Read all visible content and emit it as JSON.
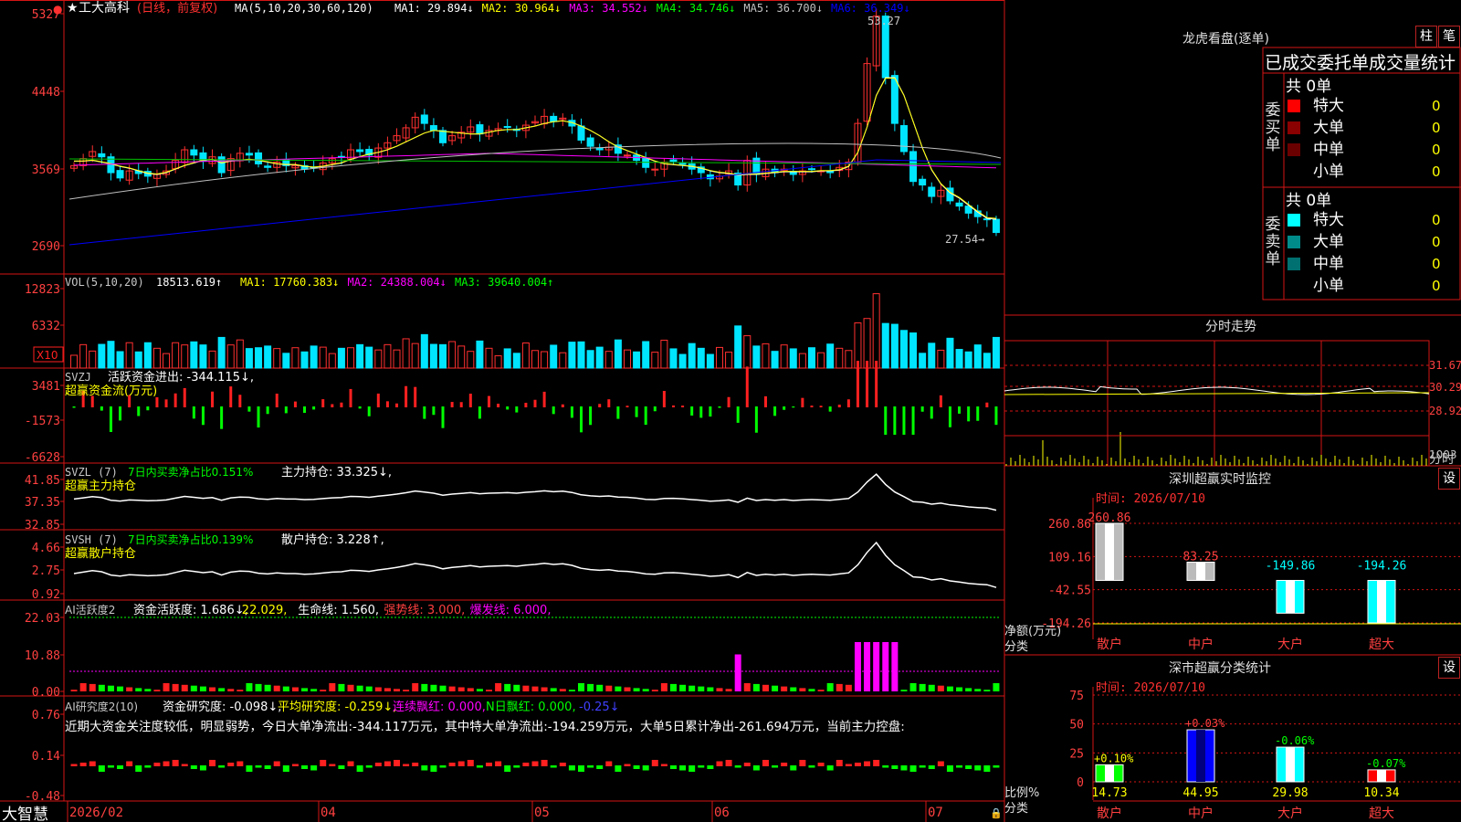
{
  "app": {
    "name": "大智慧"
  },
  "main": {
    "title": "工大高科",
    "mode": "(日线，前复权)",
    "ma_label": "MA(5,10,20,30,60,120)",
    "ma_values": [
      {
        "name": "MA1",
        "value": "29.894↓",
        "color": "#ffffff"
      },
      {
        "name": "MA2",
        "value": "30.964↓",
        "color": "#ffff00"
      },
      {
        "name": "MA3",
        "value": "34.552↓",
        "color": "#ff00ff"
      },
      {
        "name": "MA4",
        "value": "34.746↓",
        "color": "#00ff00"
      },
      {
        "name": "MA5",
        "value": "36.700↓",
        "color": "#c0c0c0"
      },
      {
        "name": "MA6",
        "value": "36.349↓",
        "color": "#0000ff"
      }
    ],
    "y_ticks": [
      "5327",
      "4448",
      "3569",
      "2690"
    ],
    "high_label": "53.27",
    "low_label": "27.54→"
  },
  "volume": {
    "label": "VOL(5,10,20)",
    "value": "18513.619↑",
    "ma": [
      {
        "name": "MA1",
        "value": "17760.383↓",
        "color": "#ffff00"
      },
      {
        "name": "MA2",
        "value": "24388.004↓",
        "color": "#ff00ff"
      },
      {
        "name": "MA3",
        "value": "39640.004↑",
        "color": "#00ff00"
      }
    ],
    "y_ticks": [
      "12823",
      "6332"
    ],
    "unit": "X10"
  },
  "svzj": {
    "label": "SVZJ",
    "text": "活跃资金进出: -344.115↓,",
    "sub": "超赢资金流(万元)",
    "y_ticks": [
      "3481",
      "-1573",
      "-6628"
    ]
  },
  "svzl": {
    "label": "SVZL (7)",
    "green_text": "7日内买卖净占比0.151%",
    "text": "主力持仓: 33.325↓,",
    "sub": "超赢主力持仓",
    "y_ticks": [
      "41.85",
      "37.35",
      "32.85"
    ]
  },
  "svsh": {
    "label": "SVSH (7)",
    "green_text": "7日内买卖净占比0.139%",
    "text": "散户持仓: 3.228↑,",
    "sub": "超赢散户持仓",
    "y_ticks": [
      "4.66",
      "2.75",
      "0.92"
    ]
  },
  "ai_active": {
    "label": "AI活跃度2",
    "parts": [
      {
        "text": "资金活跃度: 1.686↓,",
        "color": "#ffffff"
      },
      {
        "text": "22.029,",
        "color": "#ffff00"
      },
      {
        "text": "生命线: 1.560,",
        "color": "#ffffff"
      },
      {
        "text": "强势线: 3.000,",
        "color": "#ff4040"
      },
      {
        "text": "爆发线: 6.000,",
        "color": "#ff00ff"
      }
    ],
    "y_ticks": [
      "22.03",
      "10.88",
      "0.00"
    ]
  },
  "ai_research": {
    "label": "AI研究度2(10)",
    "parts": [
      {
        "text": "资金研究度: -0.098↓,",
        "color": "#ffffff"
      },
      {
        "text": "平均研究度: -0.259↓,",
        "color": "#ffff00"
      },
      {
        "text": "连续飘红: 0.000,",
        "color": "#ff00ff"
      },
      {
        "text": "N日飘红: 0.000,",
        "color": "#00ff00"
      },
      {
        "text": "-0.25↓",
        "color": "#4040ff"
      }
    ],
    "comment": "近期大资金关注度较低，明显弱势，今日大单净流出:-344.117万元，其中特大单净流出:-194.259万元，大单5日累计净出-261.694万元，当前主力控盘:",
    "y_ticks": [
      "0.76",
      "0.14",
      "-0.48"
    ]
  },
  "x_axis": {
    "labels": [
      "2026/02",
      "04",
      "05",
      "06",
      "07"
    ]
  },
  "dragon": {
    "title": "龙虎看盘(逐单)",
    "btn1": "柱",
    "btn2": "笔",
    "header": "已成交委托单成交量统计",
    "buy": {
      "side": "委买单",
      "total": "共 0单",
      "rows": [
        {
          "name": "特大",
          "val": "0",
          "pct": "0%",
          "color": "#ff0000"
        },
        {
          "name": "大单",
          "val": "0",
          "pct": "0%",
          "color": "#8b0000"
        },
        {
          "name": "中单",
          "val": "0",
          "pct": "0%",
          "color": "#6b0000"
        },
        {
          "name": "小单",
          "val": "0",
          "pct": "0%",
          "color": "#000000"
        }
      ]
    },
    "sell": {
      "side": "委卖单",
      "total": "共 0单",
      "rows": [
        {
          "name": "特大",
          "val": "0",
          "pct": "0%",
          "color": "#00ffff"
        },
        {
          "name": "大单",
          "val": "0",
          "pct": "0%",
          "color": "#008b8b"
        },
        {
          "name": "中单",
          "val": "0",
          "pct": "0%",
          "color": "#007070"
        },
        {
          "name": "小单",
          "val": "0",
          "pct": "0%",
          "color": "#000000"
        }
      ]
    }
  },
  "intraday": {
    "title": "分时走势",
    "y_ticks": [
      "31.67",
      "30.29",
      "28.92"
    ],
    "vol_tick": "1003",
    "vol_unit": "分时"
  },
  "sz_monitor": {
    "title": "深圳超赢实时监控",
    "btn": "设",
    "time": "时间: 2026/07/10",
    "y_ticks": [
      "260.86",
      "109.16",
      "-42.55",
      "-194.26"
    ],
    "ylabel": "净额(万元)",
    "xlabel": "分类"
  },
  "sz_class": {
    "title": "深市超赢分类统计",
    "btn": "设",
    "time": "时间: 2026/07/10",
    "y_ticks": [
      "75",
      "50",
      "25",
      "0"
    ],
    "ylabel": "比例%",
    "xlabel": "分类"
  },
  "chart_data": [
    {
      "type": "bar",
      "title": "深圳超赢实时监控",
      "ylabel": "净额(万元)",
      "xlabel": "分类",
      "categories": [
        "散户",
        "中户",
        "大户",
        "超大"
      ],
      "values": [
        260.86,
        83.25,
        -149.86,
        -194.26
      ],
      "labels": [
        "260.86",
        "83.25",
        "-149.86",
        "-194.26"
      ],
      "ylim": [
        -194.26,
        260.86
      ]
    },
    {
      "type": "bar",
      "title": "深市超赢分类统计",
      "ylabel": "比例%",
      "xlabel": "分类",
      "categories": [
        "散户",
        "中户",
        "大户",
        "超大"
      ],
      "values": [
        14.73,
        44.95,
        29.98,
        10.34
      ],
      "labels": [
        "14.73",
        "44.95",
        "29.98",
        "10.34"
      ],
      "changes": [
        "+0.10%",
        "+0.03%",
        "-0.06%",
        "-0.07%"
      ],
      "colors": [
        "#00ff00",
        "#0000ff",
        "#00ffff",
        "#ff0000"
      ],
      "ylim": [
        0,
        75
      ]
    },
    {
      "type": "line",
      "title": "工大高科",
      "series": [
        {
          "name": "close",
          "values": [
            36.0,
            36.8,
            37.6,
            37.0,
            35.2,
            34.6,
            35.4,
            35.1,
            34.8,
            35.0,
            35.4,
            36.6,
            37.8,
            37.2,
            36.5,
            37.0,
            35.2,
            36.8,
            37.4,
            37.2,
            36.2,
            35.8,
            36.4,
            36.0,
            36.0,
            35.6,
            35.8,
            36.3,
            36.8,
            37.0,
            37.8,
            37.6,
            37.2,
            38.0,
            38.6,
            39.4,
            40.3,
            41.5,
            40.8,
            40.0,
            38.6,
            39.4,
            39.8,
            40.4,
            39.6,
            40.0,
            40.2,
            40.4,
            40.0,
            40.6,
            41.0,
            41.6,
            41.0,
            41.4,
            40.5,
            38.9,
            38.2,
            37.8,
            38.1,
            37.4,
            37.2,
            36.6,
            35.8,
            35.6,
            36.4,
            36.5,
            36.2,
            35.6,
            35.2,
            34.5,
            34.8,
            35.4,
            33.8,
            36.6,
            35.0,
            35.6,
            35.2,
            35.6,
            35.0,
            35.4,
            35.6,
            35.4,
            35.2,
            35.8,
            36.4,
            40.8,
            47.6,
            53.0,
            46.0,
            40.8,
            37.6,
            34.2,
            33.8,
            32.5,
            33.2,
            32.0,
            31.4,
            30.6,
            30.2,
            29.9,
            28.4
          ]
        },
        {
          "name": "MA1",
          "values": [
            36.5,
            36.5,
            36.6,
            36.4,
            36.2,
            35.9,
            35.7,
            35.4,
            35.1,
            35.0,
            35.2,
            35.6,
            36.0,
            36.3,
            36.6,
            36.7,
            36.3,
            36.5,
            36.6,
            36.7,
            36.6,
            36.4,
            36.2,
            36.1,
            36.1,
            35.9,
            35.8,
            35.9,
            36.1,
            36.3,
            36.7,
            37.0,
            37.3,
            37.5,
            37.8,
            38.2,
            38.7,
            39.2,
            39.7,
            40.0,
            39.9,
            39.8,
            39.7,
            39.6,
            39.6,
            39.8,
            40.0,
            40.1,
            40.1,
            40.3,
            40.5,
            40.8,
            41.0,
            41.1,
            40.9,
            40.5,
            40.0,
            39.4,
            38.7,
            38.1,
            37.7,
            37.3,
            36.9,
            36.5,
            36.2,
            36.1,
            36.0,
            35.9,
            35.7,
            35.4,
            35.2,
            35.1,
            34.9,
            35.0,
            35.0,
            35.1,
            35.2,
            35.3,
            35.3,
            35.3,
            35.3,
            35.4,
            35.4,
            35.5,
            35.9,
            37.5,
            40.4,
            44.0,
            46.0,
            46.0,
            44.0,
            41.0,
            38.0,
            35.5,
            33.9,
            32.9,
            32.3,
            31.5,
            30.7,
            30.0,
            29.9
          ]
        }
      ]
    }
  ]
}
